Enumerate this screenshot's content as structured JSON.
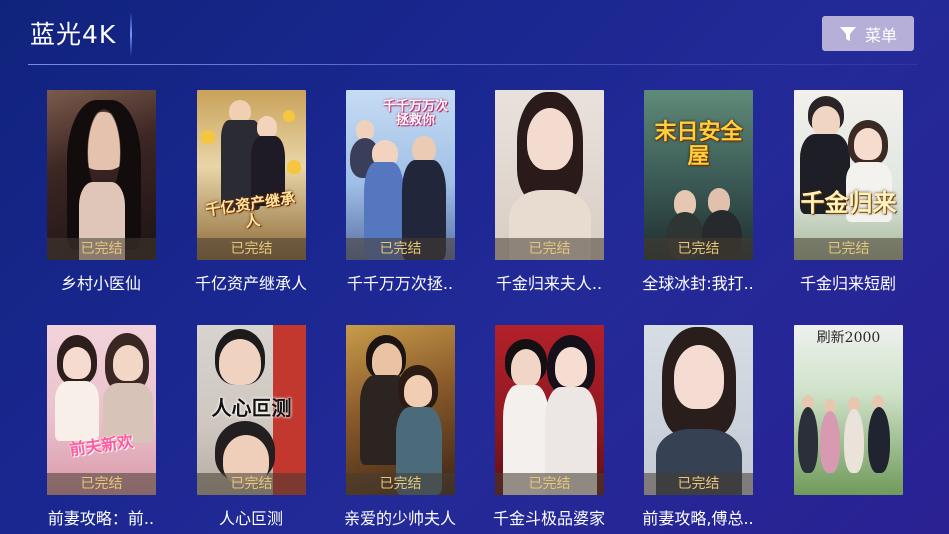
{
  "header": {
    "title": "蓝光4K",
    "menu_label": "菜单",
    "menu_icon": "filter-icon"
  },
  "colors": {
    "badge_text": "#e7c67a",
    "menu_button_bg": "#b6b0d9",
    "background": "#1a2790"
  },
  "items": [
    {
      "title": "乡村小医仙",
      "status": "已完结",
      "poster_text": ""
    },
    {
      "title": "千亿资产继承人",
      "status": "已完结",
      "poster_text": "千亿资产继承人"
    },
    {
      "title": "千千万万次拯..",
      "status": "已完结",
      "poster_text": "千千万万次拯救你"
    },
    {
      "title": "千金归来夫人..",
      "status": "已完结",
      "poster_text": ""
    },
    {
      "title": "全球冰封:我打..",
      "status": "已完结",
      "poster_text": "末日安全屋"
    },
    {
      "title": "千金归来短剧",
      "status": "已完结",
      "poster_text": "千金归来"
    },
    {
      "title": "前妻攻略：前..",
      "status": "已完结",
      "poster_text": "前夫新欢"
    },
    {
      "title": "人心叵测",
      "status": "已完结",
      "poster_text": "人心叵测"
    },
    {
      "title": "亲爱的少帅夫人",
      "status": "已完结",
      "poster_text": ""
    },
    {
      "title": "千金斗极品婆家",
      "status": "已完结",
      "poster_text": ""
    },
    {
      "title": "前妻攻略,傅总..",
      "status": "已完结",
      "poster_text": ""
    },
    {
      "title": "",
      "status": "",
      "poster_text": "刷新2000"
    }
  ]
}
